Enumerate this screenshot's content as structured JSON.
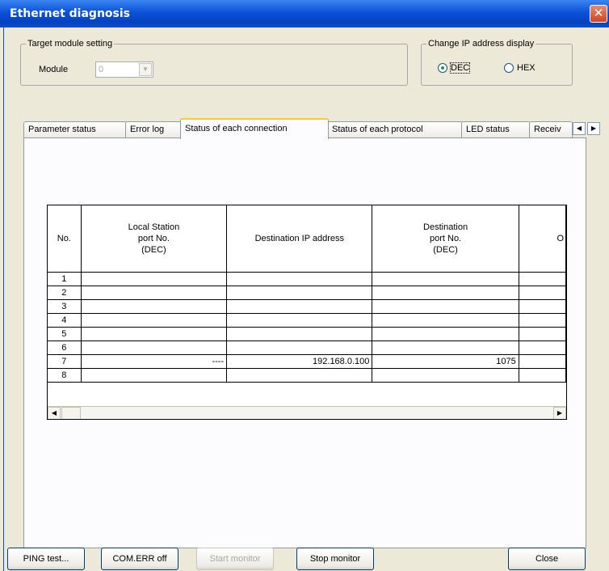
{
  "window": {
    "title": "Ethernet diagnosis"
  },
  "target": {
    "legend": "Target module setting",
    "module_label": "Module",
    "module_value": "0"
  },
  "ip_display": {
    "legend": "Change IP address display",
    "options": [
      "DEC",
      "HEX"
    ],
    "selected": "DEC"
  },
  "tabs": [
    {
      "label": "Parameter status",
      "active": false
    },
    {
      "label": "Error log",
      "active": false
    },
    {
      "label": "Status of each connection",
      "active": true
    },
    {
      "label": "Status of each protocol",
      "active": false
    },
    {
      "label": "LED status",
      "active": false
    },
    {
      "label": "Receiv",
      "active": false
    }
  ],
  "table": {
    "headers": [
      "No.",
      "Local Station\nport No.\n(DEC)",
      "Destination IP address",
      "Destination\nport No.\n(DEC)",
      "O"
    ],
    "rows": [
      [
        "1",
        "",
        "",
        "",
        ""
      ],
      [
        "2",
        "",
        "",
        "",
        ""
      ],
      [
        "3",
        "",
        "",
        "",
        ""
      ],
      [
        "4",
        "",
        "",
        "",
        ""
      ],
      [
        "5",
        "",
        "",
        "",
        ""
      ],
      [
        "6",
        "",
        "",
        "",
        ""
      ],
      [
        "7",
        "----",
        "192.168.0.100",
        "1075",
        ""
      ],
      [
        "8",
        "",
        "",
        "",
        ""
      ]
    ]
  },
  "buttons": {
    "ping": "PING test...",
    "comerr": "COM.ERR off",
    "start": "Start monitor",
    "stop": "Stop monitor",
    "close": "Close"
  },
  "icons": {
    "close": "close-icon",
    "dropdown": "chevron-down-icon",
    "scroll_left": "triangle-left-icon",
    "scroll_right": "triangle-right-icon"
  }
}
